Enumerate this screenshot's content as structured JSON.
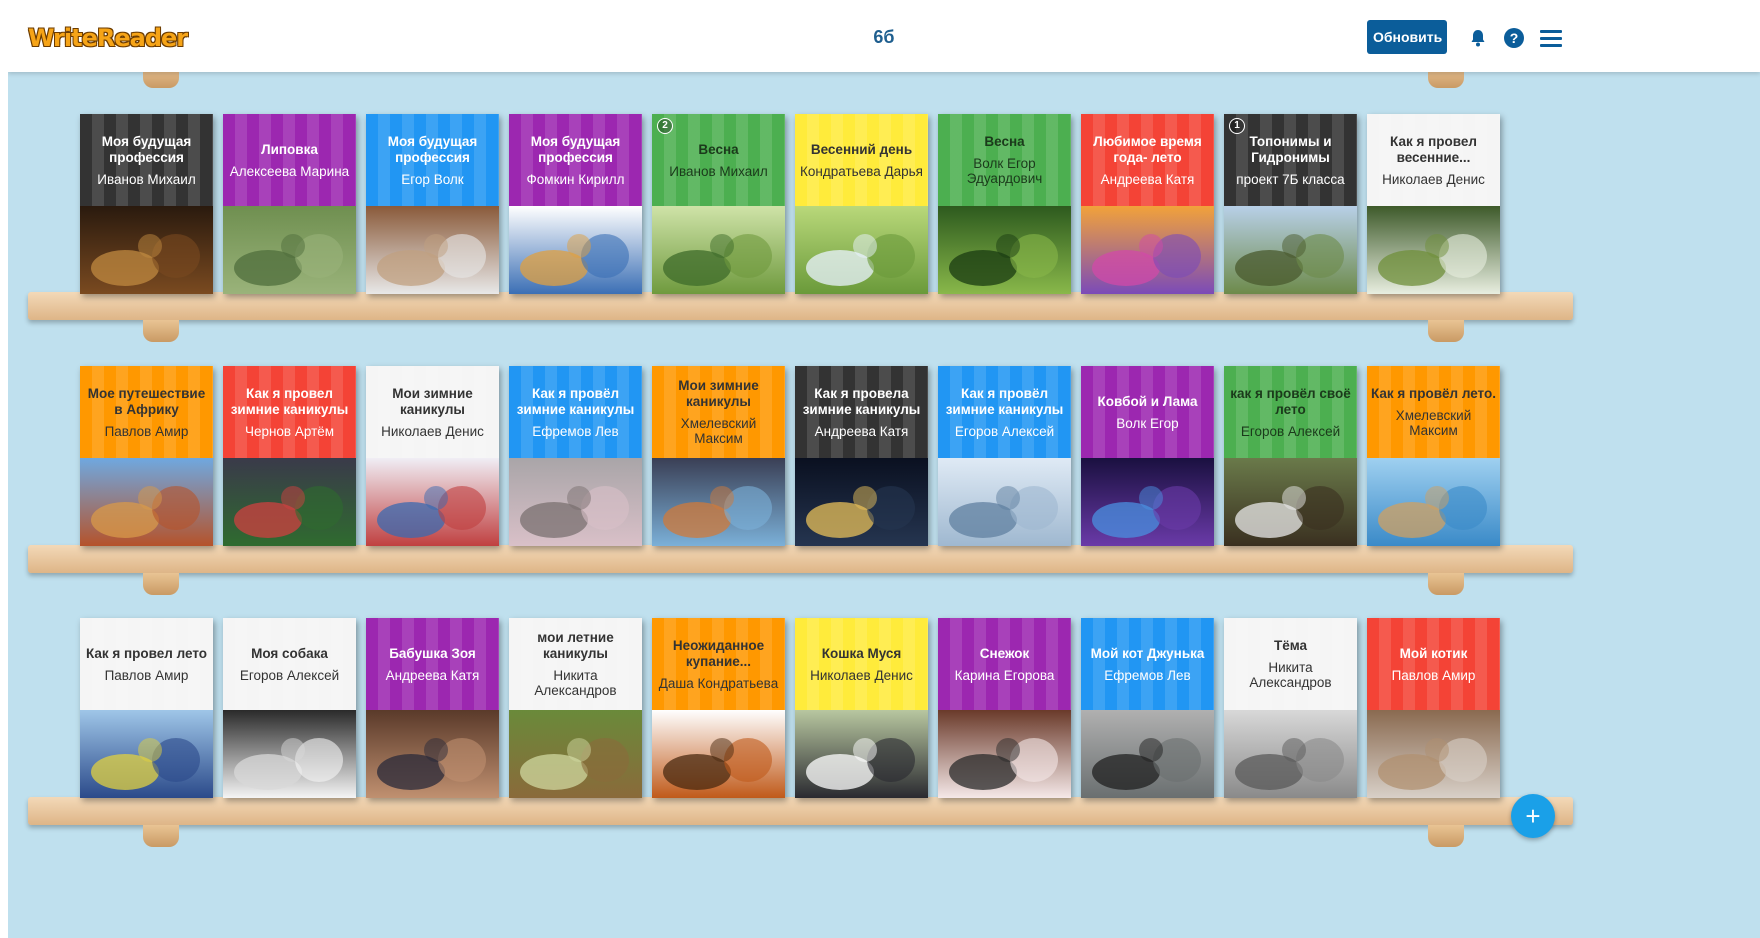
{
  "header": {
    "logo": "WriteReader",
    "class_name": "6б",
    "update_label": "Обновить",
    "icons": [
      "bell-icon",
      "help-icon",
      "menu-icon"
    ]
  },
  "fab": {
    "label": "+"
  },
  "books": [
    {
      "title": "Моя будущая профессия",
      "author": "Иванов Михаил",
      "color": "#333333",
      "text": "#ffffff",
      "scene": "law"
    },
    {
      "title": "Липовка",
      "author": "Алексеева Марина",
      "color": "#9c27b0",
      "text": "#ffffff",
      "scene": "flood"
    },
    {
      "title": "Моя будущая профессия",
      "author": "Егор Волк",
      "color": "#2196f3",
      "text": "#ffffff",
      "scene": "chefs"
    },
    {
      "title": "Моя будущая профессия",
      "author": "Фомкин Кирилл",
      "color": "#9c27b0",
      "text": "#ffffff",
      "scene": "people"
    },
    {
      "title": "Весна",
      "author": "Иванов Михаил",
      "color": "#4caf50",
      "text": "#1b3a1b",
      "scene": "branch",
      "badge": "2"
    },
    {
      "title": "Весенний день",
      "author": "Кондратьева Дарья",
      "color": "#ffeb3b",
      "text": "#333333",
      "scene": "trees"
    },
    {
      "title": "Весна",
      "author": "Волк Егор Эдуардович",
      "color": "#4caf50",
      "text": "#1b3a1b",
      "scene": "heart"
    },
    {
      "title": "Любимое время года- лето",
      "author": "Андреева Катя",
      "color": "#f44336",
      "text": "#ffffff",
      "scene": "sunset"
    },
    {
      "title": "Топонимы и Гидронимы",
      "author": "проект 7Б класса",
      "color": "#333333",
      "text": "#ffffff",
      "scene": "house",
      "badge": "1"
    },
    {
      "title": "Как я провел весенние...",
      "author": "Николаев Денис",
      "color": "#f5f5f5",
      "text": "#333333",
      "scene": "snowdrops"
    },
    {
      "title": "Мое путешествие в Африку",
      "author": "Павлов Амир",
      "color": "#ff9800",
      "text": "#333333",
      "scene": "africa"
    },
    {
      "title": "Как я провел зимние каникулы",
      "author": "Чернов Артём",
      "color": "#f44336",
      "text": "#ffffff",
      "scene": "xmas"
    },
    {
      "title": "Мои зимние каникулы",
      "author": "Николаев Денис",
      "color": "#f5f5f5",
      "text": "#333333",
      "scene": "troika"
    },
    {
      "title": "Как я провёл зимние каникулы",
      "author": "Ефремов Лев",
      "color": "#2196f3",
      "text": "#ffffff",
      "scene": "figure"
    },
    {
      "title": "Мои зимние каникулы",
      "author": "Хмелевский Максим",
      "color": "#ff9800",
      "text": "#333333",
      "scene": "party"
    },
    {
      "title": "Как я провела зимние каникулы",
      "author": "Андреева Катя",
      "color": "#333333",
      "text": "#ffffff",
      "scene": "stars"
    },
    {
      "title": "Как я провёл зимние каникулы",
      "author": "Егоров Алексей",
      "color": "#2196f3",
      "text": "#ffffff",
      "scene": "snowroad"
    },
    {
      "title": "Ковбой и Лама",
      "author": "Волк Егор",
      "color": "#9c27b0",
      "text": "#ffffff",
      "scene": "galaxy"
    },
    {
      "title": "как я провёл своё лето",
      "author": "Егоров Алексей",
      "color": "#4caf50",
      "text": "#1b3a1b",
      "scene": "swan"
    },
    {
      "title": "Как я провёл лето.",
      "author": "Хмелевский Максим",
      "color": "#ff9800",
      "text": "#333333",
      "scene": "fair"
    },
    {
      "title": "Как я провел лето",
      "author": "Павлов Амир",
      "color": "#f5f5f5",
      "text": "#333333",
      "scene": "boys"
    },
    {
      "title": "Моя собака",
      "author": "Егоров Алексей",
      "color": "#f5f5f5",
      "text": "#333333",
      "scene": "dog"
    },
    {
      "title": "Бабушка Зоя",
      "author": "Андреева Катя",
      "color": "#9c27b0",
      "text": "#ffffff",
      "scene": "family"
    },
    {
      "title": "мои летние каникулы",
      "author": "Никита Александров",
      "color": "#f5f5f5",
      "text": "#333333",
      "scene": "forest"
    },
    {
      "title": "Неожиданное купание...",
      "author": "Даша Кондратьева",
      "color": "#ff9800",
      "text": "#333333",
      "scene": "cartoon"
    },
    {
      "title": "Кошка Муся",
      "author": "Николаев Денис",
      "color": "#ffeb3b",
      "text": "#333333",
      "scene": "cat"
    },
    {
      "title": "Снежок",
      "author": "Карина Егорова",
      "color": "#9c27b0",
      "text": "#ffffff",
      "scene": "whitecat"
    },
    {
      "title": "Мой кот Джунька",
      "author": "Ефремов Лев",
      "color": "#2196f3",
      "text": "#ffffff",
      "scene": "greycat"
    },
    {
      "title": "Тёма",
      "author": "Никита Александров",
      "color": "#f5f5f5",
      "text": "#333333",
      "scene": "tabby"
    },
    {
      "title": "Мой котик",
      "author": "Павлов Амир",
      "color": "#f44336",
      "text": "#ffffff",
      "scene": "kitten"
    }
  ]
}
